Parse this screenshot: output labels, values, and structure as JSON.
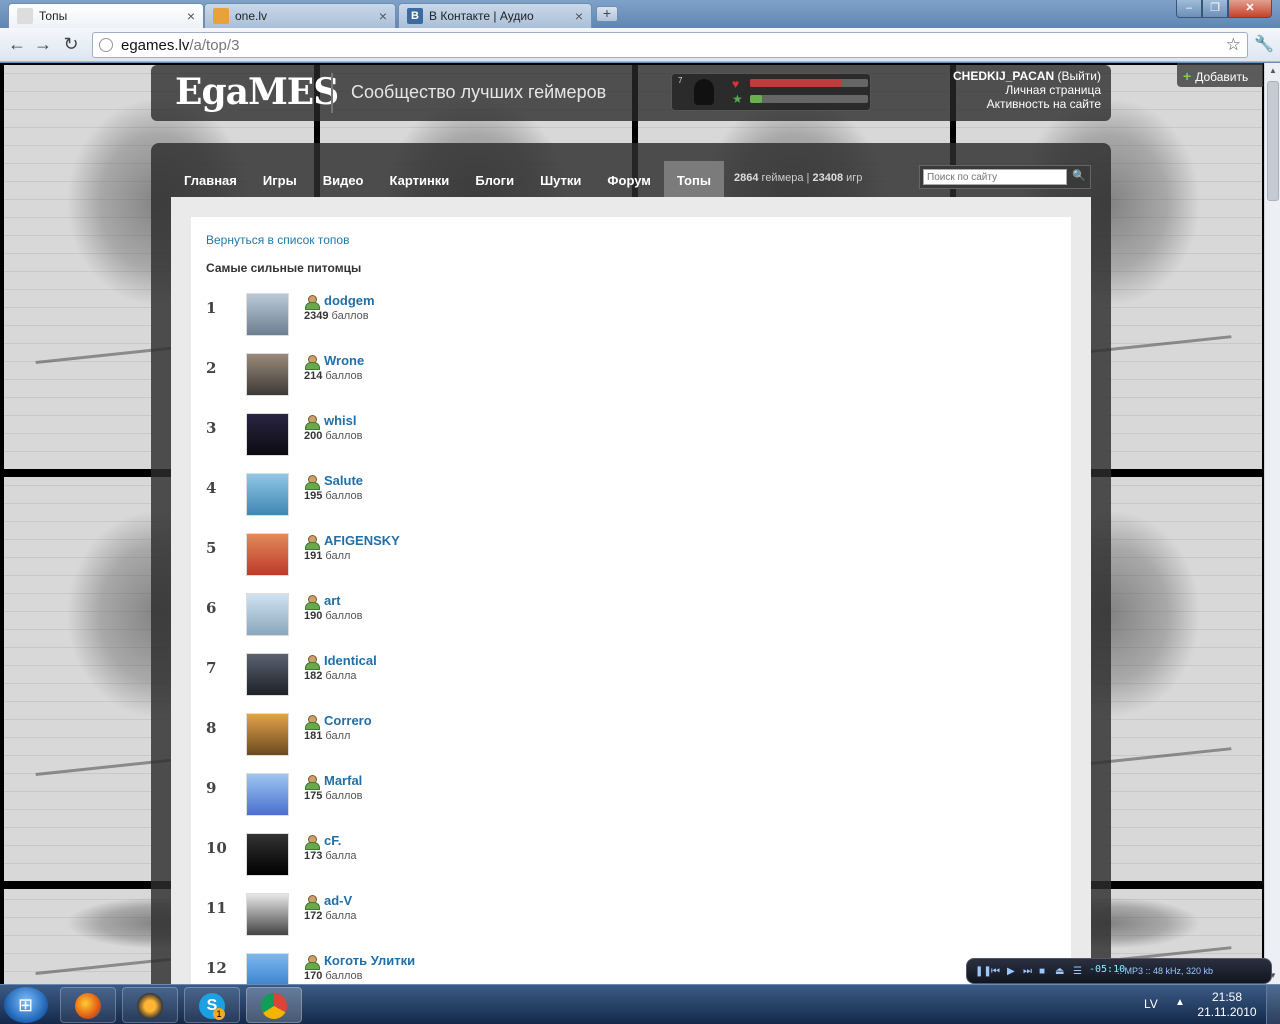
{
  "browser": {
    "tabs": [
      {
        "label": "Топы",
        "active": true
      },
      {
        "label": "one.lv",
        "active": false
      },
      {
        "label": "В Контакте | Аудио",
        "active": false
      }
    ],
    "url_host": "egames.lv",
    "url_path": "/a/top/3"
  },
  "site": {
    "logo": "EgaMES",
    "slogan": "Сообщество лучших геймеров",
    "status_level": "7",
    "health_fraction": 0.78,
    "xp_fraction": 0.1,
    "username": "CHEDKIJ_PACAN",
    "logout": "(Выйти)",
    "personal_page": "Личная страница",
    "activity": "Активность на сайте",
    "add_button": "Добавить",
    "nav": [
      "Главная",
      "Игры",
      "Видео",
      "Картинки",
      "Блоги",
      "Шутки",
      "Форум",
      "Топы"
    ],
    "active_nav": "Топы",
    "gamers_count": "2864",
    "gamers_label": "геймера",
    "games_count": "23408",
    "games_label": "игр",
    "search_placeholder": "Поиск по сайту"
  },
  "content": {
    "back_link": "Вернуться в список топов",
    "title": "Самые сильные питомцы",
    "rows": [
      {
        "rank": "1",
        "name": "dodgem",
        "points": "2349",
        "unit": "баллов"
      },
      {
        "rank": "2",
        "name": "Wrone",
        "points": "214",
        "unit": "баллов"
      },
      {
        "rank": "3",
        "name": "whisl",
        "points": "200",
        "unit": "баллов"
      },
      {
        "rank": "4",
        "name": "Salute",
        "points": "195",
        "unit": "баллов"
      },
      {
        "rank": "5",
        "name": "AFIGENSKY",
        "points": "191",
        "unit": "балл"
      },
      {
        "rank": "6",
        "name": "art",
        "points": "190",
        "unit": "баллов"
      },
      {
        "rank": "7",
        "name": "Identical",
        "points": "182",
        "unit": "балла"
      },
      {
        "rank": "8",
        "name": "Correro",
        "points": "181",
        "unit": "балл"
      },
      {
        "rank": "9",
        "name": "Marfal",
        "points": "175",
        "unit": "баллов"
      },
      {
        "rank": "10",
        "name": "cF.",
        "points": "173",
        "unit": "балла"
      },
      {
        "rank": "11",
        "name": "ad-V",
        "points": "172",
        "unit": "балла"
      },
      {
        "rank": "12",
        "name": "Коготь Улитки",
        "points": "170",
        "unit": "баллов"
      }
    ]
  },
  "player": {
    "time": "-05:10",
    "info": ":: MP3 :: 48 kHz, 320 kb"
  },
  "taskbar": {
    "lang": "LV",
    "time": "21:58",
    "date": "21.11.2010",
    "skype_badge": "1"
  },
  "colors": {
    "link": "#1f6fa8",
    "health": "#c23b3b",
    "xp": "#6ab04c"
  }
}
